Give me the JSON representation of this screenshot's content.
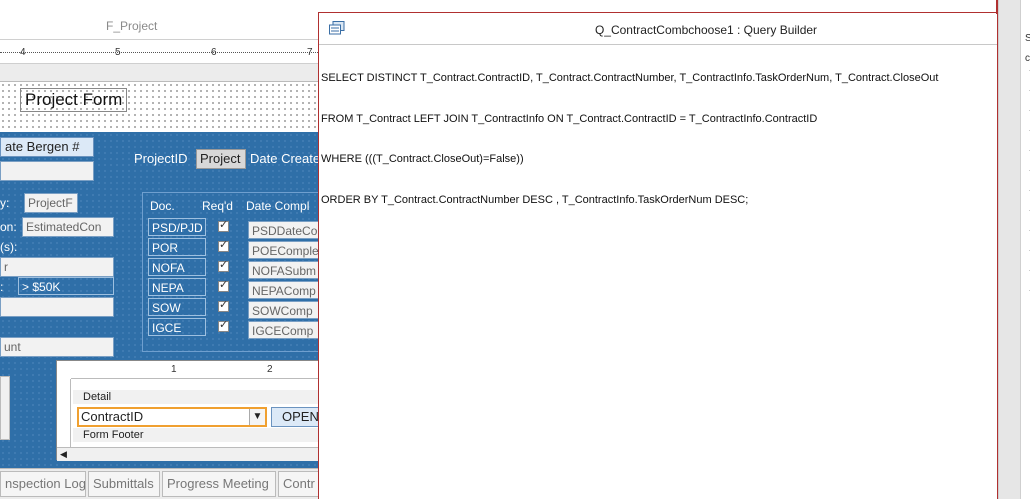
{
  "designer": {
    "window_title": "F_Project",
    "ruler_marks": [
      "4",
      "5",
      "6",
      "7"
    ],
    "header_label": "Project Form",
    "bergen_button": "ate Bergen #",
    "project_id_label": "ProjectID",
    "project_field": "Project",
    "date_created_label": "Date Create",
    "left_labels": [
      "y:",
      "on:",
      "(s):",
      "r",
      ":",
      "unt"
    ],
    "left_fields": [
      "ProjectF",
      "EstimatedCon",
      "> $50K"
    ],
    "doc_header": {
      "doc": "Doc.",
      "reqd": "Req'd",
      "date": "Date Compl"
    },
    "docs": [
      {
        "name": "PSD/PJD",
        "date_field": "PSDDateCo"
      },
      {
        "name": "POR",
        "date_field": "POEComple"
      },
      {
        "name": "NOFA",
        "date_field": "NOFASubm"
      },
      {
        "name": "NEPA",
        "date_field": "NEPAComp"
      },
      {
        "name": "SOW",
        "date_field": "SOWComp"
      },
      {
        "name": "IGCE",
        "date_field": "IGCEComp"
      }
    ],
    "subform": {
      "ruler_marks": [
        "1",
        "2"
      ],
      "detail_band": "Detail",
      "combo_value": "ContractID",
      "open_button": "OPEN",
      "footer_band": "Form Footer"
    },
    "tabs": [
      "nspection Log",
      "Submittals",
      "Progress Meeting",
      "Contr"
    ]
  },
  "query_builder": {
    "title": "Q_ContractCombchoose1 : Query Builder",
    "sql_lines": [
      "SELECT DISTINCT T_Contract.ContractID, T_Contract.ContractNumber, T_ContractInfo.TaskOrderNum, T_Contract.CloseOut",
      "FROM T_Contract LEFT JOIN T_ContractInfo ON T_Contract.ContractID = T_ContractInfo.ContractID",
      "WHERE (((T_Contract.CloseOut)=False))",
      "ORDER BY T_Contract.ContractNumber DESC , T_ContractInfo.TaskOrderNum DESC;"
    ]
  },
  "right_panel": {
    "letters": [
      "S",
      "c"
    ]
  }
}
